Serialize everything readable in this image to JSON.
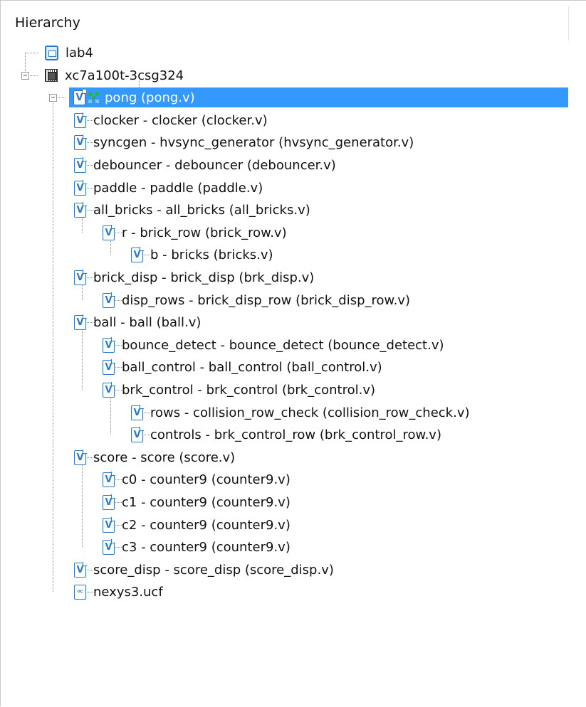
{
  "panel": {
    "title": "Hierarchy"
  },
  "icons": {
    "project": "project-icon",
    "device": "chip-icon",
    "verilog": "verilog-file-icon",
    "top_module": "top-module-icon",
    "constraint": "ucf-file-icon"
  },
  "icon_glyphs": {
    "verilog": "V",
    "constraint": "ᵁꟲ"
  },
  "colors": {
    "selection": "#3399ff",
    "icon_blue": "#2f79c6",
    "selected_text": "#ffffff"
  },
  "tree": {
    "nodes": [
      {
        "label": "lab4",
        "icon": "project"
      },
      {
        "label": "xc7a100t-3csg324",
        "icon": "device",
        "expanded": true
      },
      {
        "label": "pong (pong.v)",
        "icon": "verilog",
        "top": true,
        "selected": true,
        "expanded": true
      },
      {
        "label": "clocker - clocker (clocker.v)",
        "icon": "verilog"
      },
      {
        "label": "syncgen - hvsync_generator (hvsync_generator.v)",
        "icon": "verilog"
      },
      {
        "label": "debouncer - debouncer (debouncer.v)",
        "icon": "verilog"
      },
      {
        "label": "paddle - paddle (paddle.v)",
        "icon": "verilog"
      },
      {
        "label": "all_bricks - all_bricks (all_bricks.v)",
        "icon": "verilog",
        "expanded": true
      },
      {
        "label": "r - brick_row (brick_row.v)",
        "icon": "verilog",
        "expanded": true
      },
      {
        "label": "b - bricks (bricks.v)",
        "icon": "verilog"
      },
      {
        "label": "brick_disp - brick_disp (brk_disp.v)",
        "icon": "verilog",
        "expanded": true
      },
      {
        "label": "disp_rows - brick_disp_row (brick_disp_row.v)",
        "icon": "verilog"
      },
      {
        "label": "ball - ball (ball.v)",
        "icon": "verilog",
        "expanded": true
      },
      {
        "label": "bounce_detect - bounce_detect (bounce_detect.v)",
        "icon": "verilog"
      },
      {
        "label": "ball_control - ball_control (ball_control.v)",
        "icon": "verilog"
      },
      {
        "label": "brk_control - brk_control (brk_control.v)",
        "icon": "verilog",
        "expanded": true
      },
      {
        "label": "rows - collision_row_check (collision_row_check.v)",
        "icon": "verilog"
      },
      {
        "label": "controls - brk_control_row (brk_control_row.v)",
        "icon": "verilog"
      },
      {
        "label": "score - score (score.v)",
        "icon": "verilog",
        "expanded": true
      },
      {
        "label": "c0 - counter9 (counter9.v)",
        "icon": "verilog"
      },
      {
        "label": "c1 - counter9 (counter9.v)",
        "icon": "verilog"
      },
      {
        "label": "c2 - counter9 (counter9.v)",
        "icon": "verilog"
      },
      {
        "label": "c3 - counter9 (counter9.v)",
        "icon": "verilog"
      },
      {
        "label": "score_disp - score_disp (score_disp.v)",
        "icon": "verilog"
      },
      {
        "label": "nexys3.ucf",
        "icon": "constraint"
      }
    ]
  }
}
